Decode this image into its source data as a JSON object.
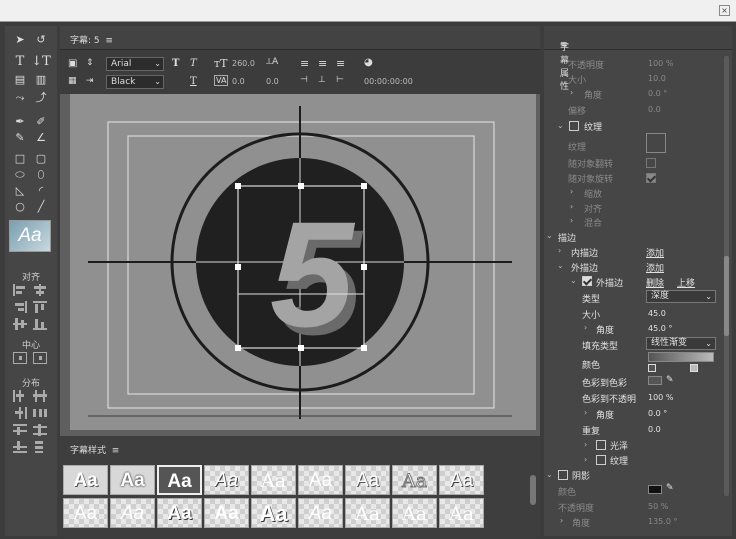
{
  "window": {
    "close_glyph": "×"
  },
  "tools": {
    "align_label": "对齐",
    "center_label": "中心",
    "distribute_label": "分布",
    "style_preview": "Aa"
  },
  "editor": {
    "title": "字幕: 5",
    "menu_glyph": "≡",
    "font_family": "Arial",
    "font_style": "Black",
    "font_size": "260.0",
    "kerning": "0.0",
    "leading": "0.0",
    "baseline": "0.0",
    "timecode": "00:00:00:00",
    "canvas_text": "5"
  },
  "styles_panel": {
    "title": "字幕样式",
    "menu_glyph": "≡",
    "swatch_text": "Aa"
  },
  "props": {
    "title": "字幕属性",
    "menu_glyph": "≡",
    "opacity_label": "不透明度",
    "opacity_value": "100 %",
    "size_label": "大小",
    "size_value": "10.0",
    "angle_label": "角度",
    "angle_value": "0.0 °",
    "offset_label": "偏移",
    "offset_value": "0.0",
    "texture_section": "纹理",
    "texture_label": "纹理",
    "flip_label": "随对象翻转",
    "rotate_label": "随对象旋转",
    "scale_label": "缩放",
    "align_label": "对齐",
    "blend_label": "混合",
    "stroke_section": "描边",
    "inner_stroke": "内描边",
    "add1": "添加",
    "outer_stroke": "外描边",
    "add2": "添加",
    "outer_stroke_item": "外描边",
    "delete": "删除",
    "move_up": "上移",
    "type_label": "类型",
    "type_value": "深度",
    "size2_label": "大小",
    "size2_value": "45.0",
    "angle2_label": "角度",
    "angle2_value": "45.0 °",
    "fill_type_label": "填充类型",
    "fill_type_value": "线性渐变",
    "color_label": "颜色",
    "color_to_color": "色彩到色彩",
    "color_to_opacity": "色彩到不透明",
    "color_to_opacity_value": "100 %",
    "angle3_label": "角度",
    "angle3_value": "0.0 °",
    "repeat_label": "重复",
    "repeat_value": "0.0",
    "sheen_label": "光泽",
    "texture2_label": "纹理",
    "shadow_section": "阴影",
    "shadow_color_label": "颜色",
    "shadow_opacity_label": "不透明度",
    "shadow_opacity_value": "50 %",
    "shadow_angle_label": "角度",
    "shadow_angle_value": "135.0 °"
  }
}
